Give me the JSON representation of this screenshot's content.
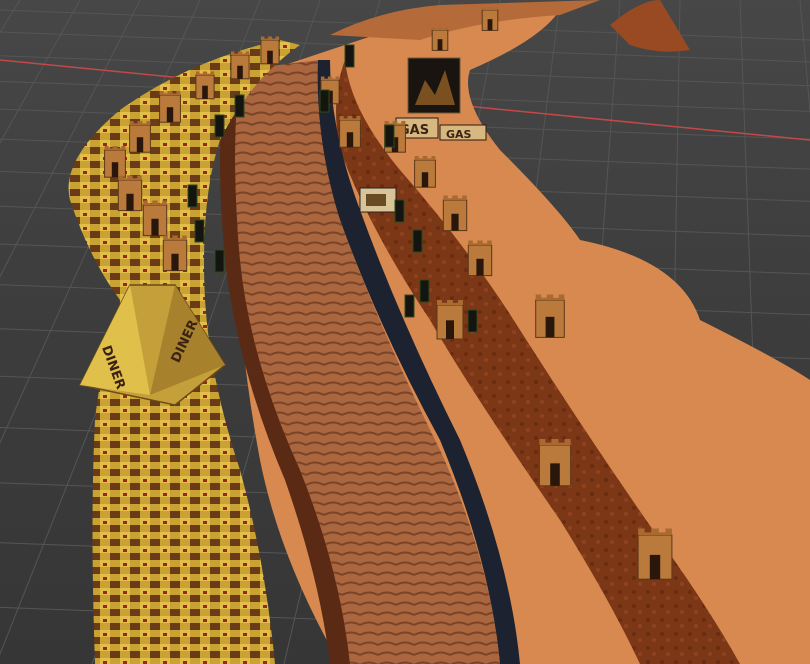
{
  "scene": {
    "gas_sign": "GAS",
    "diner_sign": "DINER",
    "colors": {
      "background": "#3d3d3d",
      "grid_line": "#555555",
      "axis_x": "#c44848",
      "terrain_light": "#d8894f",
      "terrain_mid": "#c06f37",
      "road_dark": "#7a3515",
      "rail_bed": "#a1603c",
      "gutter_blue": "#1c2230",
      "wall_yellow": "#d8b23a",
      "building_brown": "#b97a3c"
    },
    "icons": [
      "building-icon",
      "sign-icon",
      "cactus-icon"
    ]
  }
}
